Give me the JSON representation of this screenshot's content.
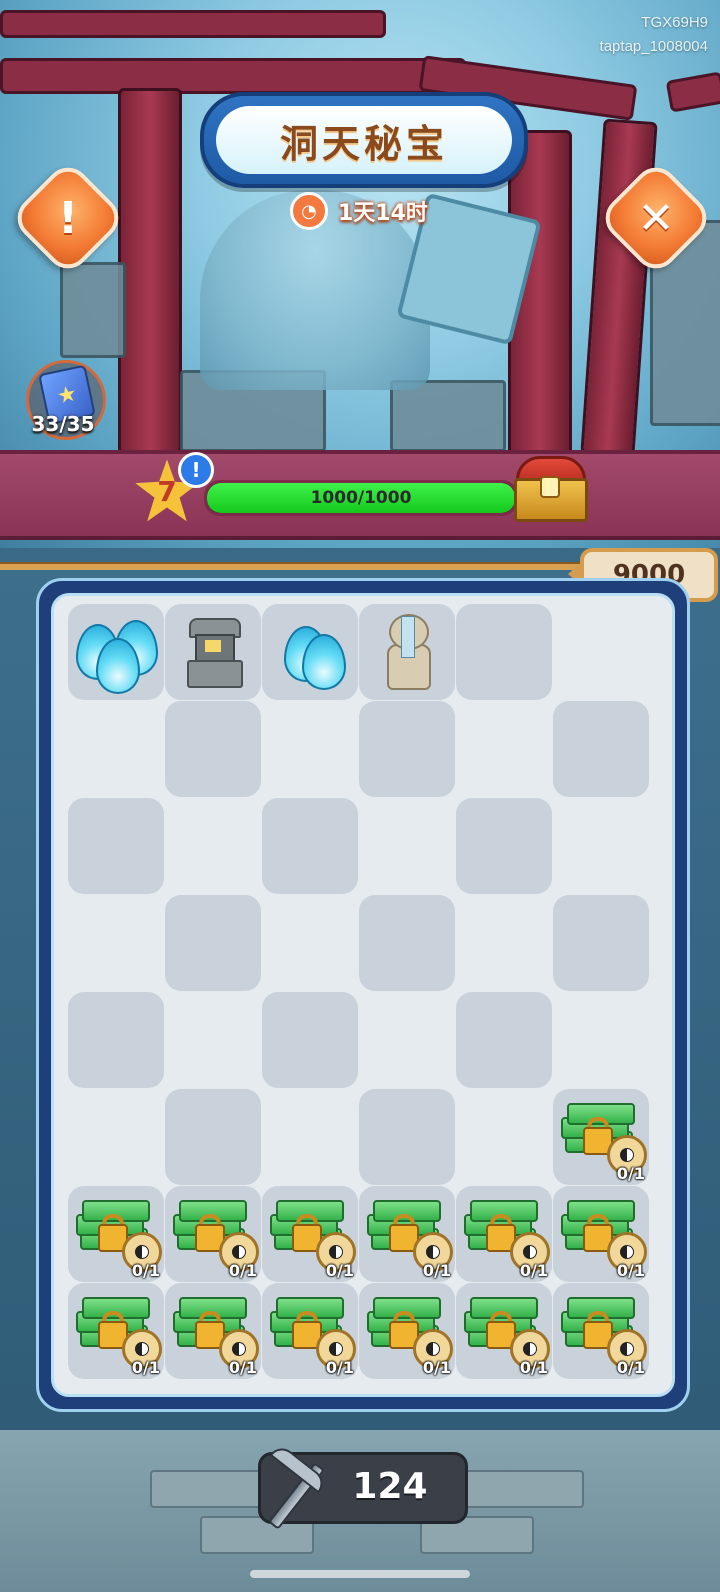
{
  "watermark": {
    "line1": "TGX69H9",
    "line2": "taptap_1008004"
  },
  "header": {
    "title": "洞天秘宝",
    "timer_icon": "clock-icon",
    "timer": "1天14时",
    "info_button_glyph": "!",
    "close_button_glyph": "✕"
  },
  "album": {
    "icon": "star-book-icon",
    "count": "33/35"
  },
  "progress": {
    "level": "7",
    "alert": "!",
    "value": 1000,
    "max": 1000,
    "text": "1000/1000",
    "reward_icon": "treasure-chest-icon"
  },
  "score": "9000",
  "board": {
    "cols": 6,
    "rows": 8,
    "cells": [
      "flame3",
      "lantern",
      "flame2",
      "monk",
      "gray",
      "empty",
      "empty",
      "gray",
      "empty",
      "gray",
      "empty",
      "gray",
      "gray",
      "empty",
      "gray",
      "empty",
      "gray",
      "empty",
      "empty",
      "gray",
      "empty",
      "gray",
      "empty",
      "gray",
      "gray",
      "empty",
      "gray",
      "empty",
      "gray",
      "empty",
      "empty",
      "gray",
      "empty",
      "gray",
      "empty",
      "jade",
      "jade",
      "jade",
      "jade",
      "jade",
      "jade",
      "jade",
      "jade",
      "jade",
      "jade",
      "jade",
      "jade",
      "jade"
    ],
    "locked_label": "0/1"
  },
  "pickaxe": {
    "icon": "pickaxe-icon",
    "count": "124"
  },
  "colors": {
    "progress_fill": "#1ed629",
    "title_plate": "#2f74c3",
    "score_border": "#d59c4d"
  }
}
